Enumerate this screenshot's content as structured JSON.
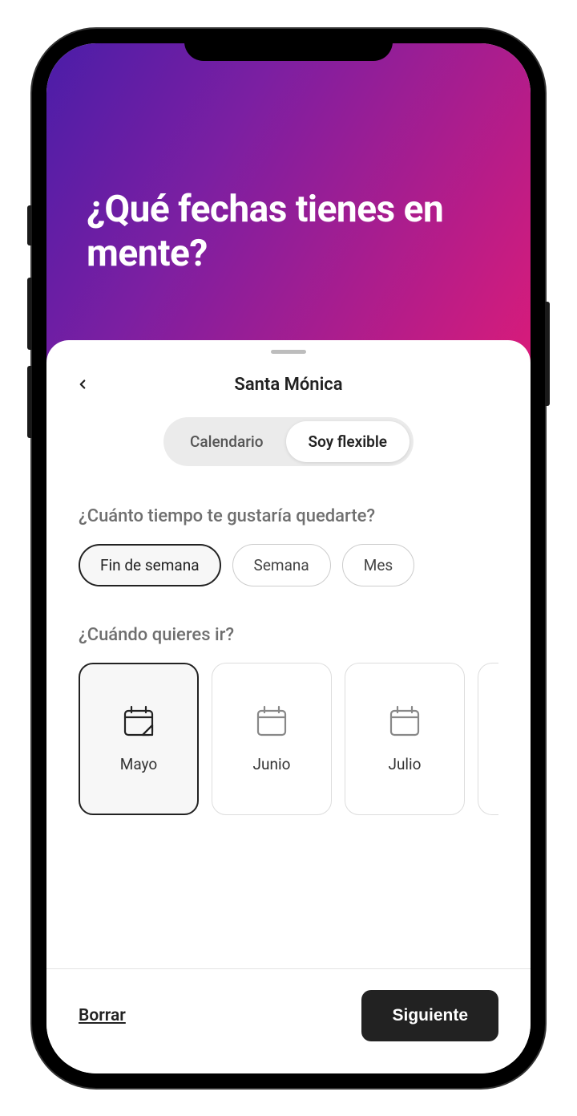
{
  "header": {
    "title": "¿Qué fechas tienes en mente?"
  },
  "sheet": {
    "location": "Santa Mónica",
    "tabs": {
      "calendar": "Calendario",
      "flexible": "Soy flexible",
      "active": "flexible"
    }
  },
  "duration": {
    "label": "¿Cuánto tiempo te gustaría quedarte?",
    "options": [
      {
        "key": "weekend",
        "label": "Fin de semana",
        "selected": true
      },
      {
        "key": "week",
        "label": "Semana",
        "selected": false
      },
      {
        "key": "month",
        "label": "Mes",
        "selected": false
      }
    ]
  },
  "when": {
    "label": "¿Cuándo quieres ir?",
    "months": [
      {
        "key": "mayo",
        "label": "Mayo",
        "selected": true
      },
      {
        "key": "junio",
        "label": "Junio",
        "selected": false
      },
      {
        "key": "julio",
        "label": "Julio",
        "selected": false
      }
    ]
  },
  "footer": {
    "clear": "Borrar",
    "next": "Siguiente"
  }
}
